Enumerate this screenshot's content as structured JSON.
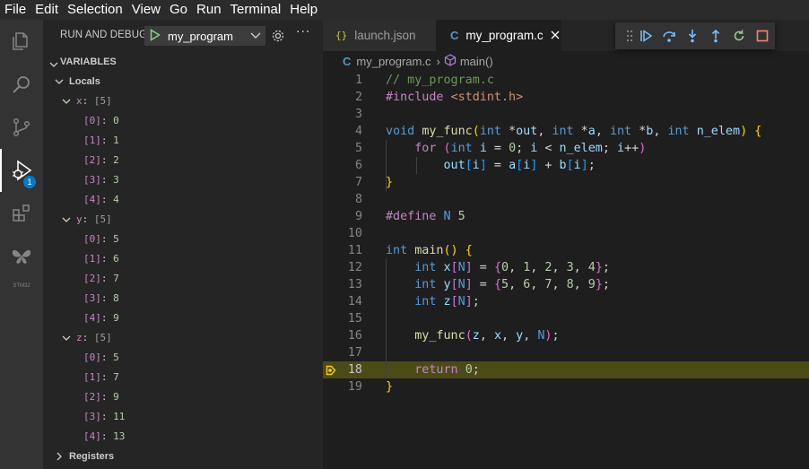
{
  "menu": [
    "File",
    "Edit",
    "Selection",
    "View",
    "Go",
    "Run",
    "Terminal",
    "Help"
  ],
  "activity": {
    "debug_badge": "1",
    "stm32_label": "STM32"
  },
  "sidebar": {
    "title": "RUN AND DEBUG",
    "config_name": "my_program",
    "variables_title": "VARIABLES",
    "locals_label": "Locals",
    "registers_label": "Registers",
    "vars": [
      {
        "name": "x",
        "summary": "[5]",
        "items": [
          {
            "idx": "[0]",
            "value": "0"
          },
          {
            "idx": "[1]",
            "value": "1"
          },
          {
            "idx": "[2]",
            "value": "2"
          },
          {
            "idx": "[3]",
            "value": "3"
          },
          {
            "idx": "[4]",
            "value": "4"
          }
        ]
      },
      {
        "name": "y",
        "summary": "[5]",
        "items": [
          {
            "idx": "[0]",
            "value": "5"
          },
          {
            "idx": "[1]",
            "value": "6"
          },
          {
            "idx": "[2]",
            "value": "7"
          },
          {
            "idx": "[3]",
            "value": "8"
          },
          {
            "idx": "[4]",
            "value": "9"
          }
        ]
      },
      {
        "name": "z",
        "summary": "[5]",
        "items": [
          {
            "idx": "[0]",
            "value": "5"
          },
          {
            "idx": "[1]",
            "value": "7"
          },
          {
            "idx": "[2]",
            "value": "9"
          },
          {
            "idx": "[3]",
            "value": "11"
          },
          {
            "idx": "[4]",
            "value": "13"
          }
        ]
      }
    ]
  },
  "tabs": [
    {
      "icon": "{}",
      "label": "launch.json",
      "active": false
    },
    {
      "icon": "C",
      "label": "my_program.c",
      "active": true
    }
  ],
  "breadcrumb": {
    "file_icon": "C",
    "file": "my_program.c",
    "separator": "›",
    "symbol": "main()"
  },
  "editor": {
    "current_line": 18,
    "lines": [
      {
        "n": "1",
        "tokens": [
          [
            "t-cmt",
            "// my_program.c"
          ]
        ]
      },
      {
        "n": "2",
        "tokens": [
          [
            "t-ctl",
            "#include"
          ],
          [
            "t-txt",
            " "
          ],
          [
            "t-str",
            "<stdint.h>"
          ]
        ]
      },
      {
        "n": "3",
        "tokens": []
      },
      {
        "n": "4",
        "tokens": [
          [
            "t-kw",
            "void"
          ],
          [
            "t-txt",
            " "
          ],
          [
            "t-fn",
            "my_func"
          ],
          [
            "t-br1",
            "("
          ],
          [
            "t-kw",
            "int"
          ],
          [
            "t-txt",
            " *"
          ],
          [
            "t-var",
            "out"
          ],
          [
            "t-txt",
            ", "
          ],
          [
            "t-kw",
            "int"
          ],
          [
            "t-txt",
            " *"
          ],
          [
            "t-var",
            "a"
          ],
          [
            "t-txt",
            ", "
          ],
          [
            "t-kw",
            "int"
          ],
          [
            "t-txt",
            " *"
          ],
          [
            "t-var",
            "b"
          ],
          [
            "t-txt",
            ", "
          ],
          [
            "t-kw",
            "int"
          ],
          [
            "t-txt",
            " "
          ],
          [
            "t-var",
            "n_elem"
          ],
          [
            "t-br1",
            ")"
          ],
          [
            "t-txt",
            " "
          ],
          [
            "t-br1",
            "{"
          ]
        ]
      },
      {
        "n": "5",
        "tokens": [
          [
            "t-txt",
            "    "
          ],
          [
            "t-ctl",
            "for"
          ],
          [
            "t-txt",
            " "
          ],
          [
            "t-br2",
            "("
          ],
          [
            "t-kw",
            "int"
          ],
          [
            "t-txt",
            " "
          ],
          [
            "t-var",
            "i"
          ],
          [
            "t-txt",
            " = "
          ],
          [
            "t-num",
            "0"
          ],
          [
            "t-txt",
            "; "
          ],
          [
            "t-var",
            "i"
          ],
          [
            "t-txt",
            " < "
          ],
          [
            "t-var",
            "n_elem"
          ],
          [
            "t-txt",
            "; "
          ],
          [
            "t-var",
            "i"
          ],
          [
            "t-txt",
            "++"
          ],
          [
            "t-br2",
            ")"
          ]
        ]
      },
      {
        "n": "6",
        "tokens": [
          [
            "t-txt",
            "        "
          ],
          [
            "t-var",
            "out"
          ],
          [
            "t-br3",
            "["
          ],
          [
            "t-var",
            "i"
          ],
          [
            "t-br3",
            "]"
          ],
          [
            "t-txt",
            " = "
          ],
          [
            "t-var",
            "a"
          ],
          [
            "t-br3",
            "["
          ],
          [
            "t-var",
            "i"
          ],
          [
            "t-br3",
            "]"
          ],
          [
            "t-txt",
            " + "
          ],
          [
            "t-var",
            "b"
          ],
          [
            "t-br3",
            "["
          ],
          [
            "t-var",
            "i"
          ],
          [
            "t-br3",
            "]"
          ],
          [
            "t-txt",
            ";"
          ]
        ]
      },
      {
        "n": "7",
        "tokens": [
          [
            "t-br1",
            "}"
          ]
        ]
      },
      {
        "n": "8",
        "tokens": []
      },
      {
        "n": "9",
        "tokens": [
          [
            "t-ctl",
            "#define"
          ],
          [
            "t-txt",
            " "
          ],
          [
            "t-macro",
            "N"
          ],
          [
            "t-txt",
            " "
          ],
          [
            "t-num",
            "5"
          ]
        ]
      },
      {
        "n": "10",
        "tokens": []
      },
      {
        "n": "11",
        "tokens": [
          [
            "t-kw",
            "int"
          ],
          [
            "t-txt",
            " "
          ],
          [
            "t-fn",
            "main"
          ],
          [
            "t-br1",
            "()"
          ],
          [
            "t-txt",
            " "
          ],
          [
            "t-br1",
            "{"
          ]
        ]
      },
      {
        "n": "12",
        "tokens": [
          [
            "t-txt",
            "    "
          ],
          [
            "t-kw",
            "int"
          ],
          [
            "t-txt",
            " "
          ],
          [
            "t-var",
            "x"
          ],
          [
            "t-br2",
            "["
          ],
          [
            "t-macro",
            "N"
          ],
          [
            "t-br2",
            "]"
          ],
          [
            "t-txt",
            " = "
          ],
          [
            "t-br2",
            "{"
          ],
          [
            "t-num",
            "0"
          ],
          [
            "t-txt",
            ", "
          ],
          [
            "t-num",
            "1"
          ],
          [
            "t-txt",
            ", "
          ],
          [
            "t-num",
            "2"
          ],
          [
            "t-txt",
            ", "
          ],
          [
            "t-num",
            "3"
          ],
          [
            "t-txt",
            ", "
          ],
          [
            "t-num",
            "4"
          ],
          [
            "t-br2",
            "}"
          ],
          [
            "t-txt",
            ";"
          ]
        ]
      },
      {
        "n": "13",
        "tokens": [
          [
            "t-txt",
            "    "
          ],
          [
            "t-kw",
            "int"
          ],
          [
            "t-txt",
            " "
          ],
          [
            "t-var",
            "y"
          ],
          [
            "t-br2",
            "["
          ],
          [
            "t-macro",
            "N"
          ],
          [
            "t-br2",
            "]"
          ],
          [
            "t-txt",
            " = "
          ],
          [
            "t-br2",
            "{"
          ],
          [
            "t-num",
            "5"
          ],
          [
            "t-txt",
            ", "
          ],
          [
            "t-num",
            "6"
          ],
          [
            "t-txt",
            ", "
          ],
          [
            "t-num",
            "7"
          ],
          [
            "t-txt",
            ", "
          ],
          [
            "t-num",
            "8"
          ],
          [
            "t-txt",
            ", "
          ],
          [
            "t-num",
            "9"
          ],
          [
            "t-br2",
            "}"
          ],
          [
            "t-txt",
            ";"
          ]
        ]
      },
      {
        "n": "14",
        "tokens": [
          [
            "t-txt",
            "    "
          ],
          [
            "t-kw",
            "int"
          ],
          [
            "t-txt",
            " "
          ],
          [
            "t-var",
            "z"
          ],
          [
            "t-br2",
            "["
          ],
          [
            "t-macro",
            "N"
          ],
          [
            "t-br2",
            "]"
          ],
          [
            "t-txt",
            ";"
          ]
        ]
      },
      {
        "n": "15",
        "tokens": []
      },
      {
        "n": "16",
        "tokens": [
          [
            "t-txt",
            "    "
          ],
          [
            "t-fn",
            "my_func"
          ],
          [
            "t-br2",
            "("
          ],
          [
            "t-var",
            "z"
          ],
          [
            "t-txt",
            ", "
          ],
          [
            "t-var",
            "x"
          ],
          [
            "t-txt",
            ", "
          ],
          [
            "t-var",
            "y"
          ],
          [
            "t-txt",
            ", "
          ],
          [
            "t-macro",
            "N"
          ],
          [
            "t-br2",
            ")"
          ],
          [
            "t-txt",
            ";"
          ]
        ]
      },
      {
        "n": "17",
        "tokens": []
      },
      {
        "n": "18",
        "tokens": [
          [
            "t-txt",
            "    "
          ],
          [
            "t-ctl",
            "return"
          ],
          [
            "t-txt",
            " "
          ],
          [
            "t-num",
            "0"
          ],
          [
            "t-txt",
            ";"
          ]
        ]
      },
      {
        "n": "19",
        "tokens": [
          [
            "t-br1",
            "}"
          ]
        ]
      }
    ]
  }
}
